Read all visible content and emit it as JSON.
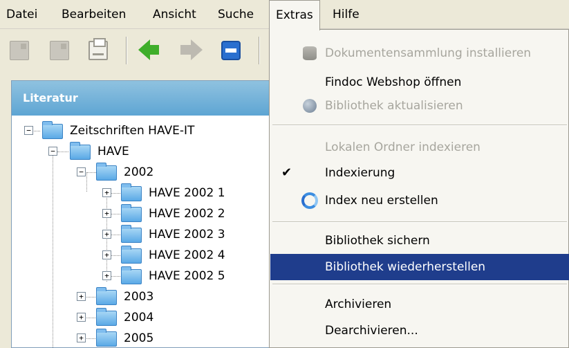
{
  "menubar": {
    "items": [
      {
        "label": "Datei"
      },
      {
        "label": "Bearbeiten"
      },
      {
        "label": "Ansicht"
      },
      {
        "label": "Suche"
      },
      {
        "label": "Extras"
      },
      {
        "label": "Hilfe"
      }
    ],
    "open_menu": "Extras"
  },
  "toolbar": {
    "icons": [
      "new-document-icon",
      "open-document-icon",
      "print-icon",
      "back-arrow-icon",
      "forward-arrow-icon",
      "navigate-back-icon"
    ]
  },
  "panel": {
    "title": "Literatur",
    "header_color": "#6aaed8",
    "tree": [
      {
        "label": "Zeitschriften HAVE-IT",
        "expander": "−"
      },
      {
        "label": "HAVE",
        "expander": "−"
      },
      {
        "label": "2002",
        "expander": "−"
      },
      {
        "label": "HAVE 2002 1",
        "expander": "+"
      },
      {
        "label": "HAVE 2002 2",
        "expander": "+"
      },
      {
        "label": "HAVE 2002 3",
        "expander": "+"
      },
      {
        "label": "HAVE 2002 4",
        "expander": "+"
      },
      {
        "label": "HAVE 2002 5",
        "expander": "+"
      },
      {
        "label": "2003",
        "expander": "+"
      },
      {
        "label": "2004",
        "expander": "+"
      },
      {
        "label": "2005",
        "expander": "+"
      }
    ]
  },
  "dropdown": {
    "items": [
      {
        "label": "Dokumentensammlung installieren",
        "disabled": true,
        "icon": "database-icon"
      },
      {
        "label": "Findoc Webshop öffnen",
        "disabled": false
      },
      {
        "label": "Bibliothek aktualisieren",
        "disabled": true,
        "icon": "globe-icon"
      },
      {
        "label": "Lokalen Ordner indexieren",
        "disabled": true
      },
      {
        "label": "Indexierung",
        "disabled": false,
        "checked": true
      },
      {
        "label": "Index neu erstellen",
        "disabled": false,
        "icon": "refresh-icon"
      },
      {
        "label": "Bibliothek sichern",
        "disabled": false
      },
      {
        "label": "Bibliothek wiederherstellen",
        "disabled": false,
        "selected": true
      },
      {
        "label": "Archivieren",
        "disabled": false
      },
      {
        "label": "Dearchivieren...",
        "disabled": false
      }
    ],
    "check_glyph": "✔",
    "selection_color": "#1f3d8c"
  }
}
